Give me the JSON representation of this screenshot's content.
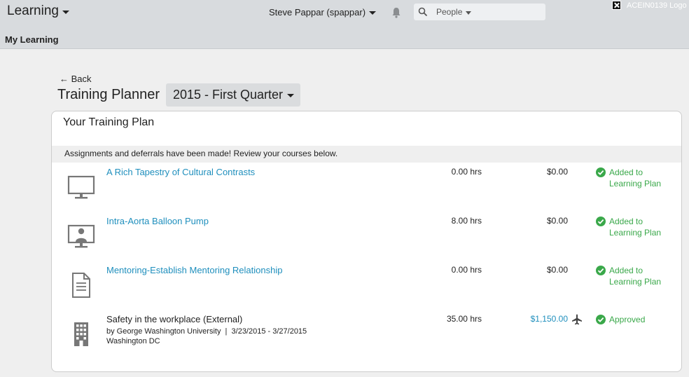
{
  "header": {
    "app_title": "Learning",
    "user": "Steve Pappar (spappar)",
    "search_scope": "People",
    "logo_alt": "ACEIN0139 Logo"
  },
  "subnav": {
    "title": "My Learning"
  },
  "page": {
    "back_label": "← Back",
    "title": "Training Planner",
    "quarter": "2015 - First Quarter"
  },
  "plan": {
    "title": "Your Training Plan",
    "notice": "Assignments and deferrals have been made! Review your courses below.",
    "courses": [
      {
        "icon": "monitor-icon",
        "title": "A Rich Tapestry of Cultural Contrasts",
        "hours": "0.00 hrs",
        "cost": "$0.00",
        "status_line1": "Added to",
        "status_line2": "Learning Plan"
      },
      {
        "icon": "virtual-classroom-icon",
        "title": "Intra-Aorta Balloon Pump",
        "hours": "8.00 hrs",
        "cost": "$0.00",
        "status_line1": "Added to",
        "status_line2": "Learning Plan"
      },
      {
        "icon": "document-icon",
        "title": "Mentoring-Establish Mentoring Relationship",
        "hours": "0.00 hrs",
        "cost": "$0.00",
        "status_line1": "Added to",
        "status_line2": "Learning Plan"
      },
      {
        "icon": "building-icon",
        "title": "Safety in the workplace (External)",
        "meta_line1": "by George Washington University  |  3/23/2015 - 3/27/2015",
        "meta_line2": "Washington DC",
        "hours": "35.00 hrs",
        "cost": "$1,150.00",
        "status_line1": "Approved"
      }
    ]
  },
  "colors": {
    "link": "#1f8fbd",
    "status_green": "#3aa84a",
    "header_bg": "#d8dbde"
  }
}
